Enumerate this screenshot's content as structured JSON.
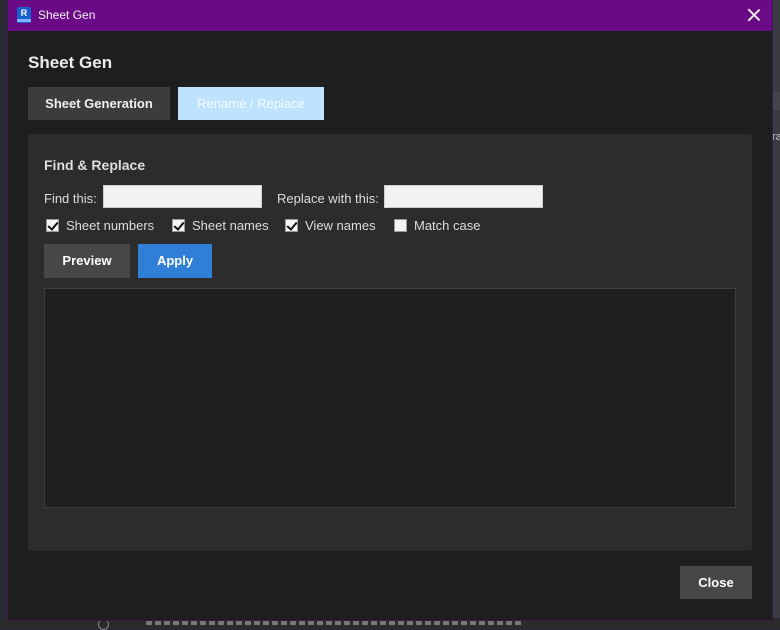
{
  "window": {
    "title": "Sheet Gen",
    "app_icon_letter": "R"
  },
  "dialog": {
    "heading": "Sheet Gen"
  },
  "tabs": [
    {
      "label": "Sheet Generation",
      "active": false
    },
    {
      "label": "Rename / Replace",
      "active": true
    }
  ],
  "find_replace": {
    "section_title": "Find & Replace",
    "find_label": "Find this:",
    "find_value": "",
    "replace_label": "Replace with this:",
    "replace_value": "",
    "options": [
      {
        "label": "Sheet numbers",
        "checked": true
      },
      {
        "label": "Sheet names",
        "checked": true
      },
      {
        "label": "View names",
        "checked": true
      },
      {
        "label": "Match case",
        "checked": false
      }
    ],
    "preview_label": "Preview",
    "apply_label": "Apply",
    "output_text": ""
  },
  "footer": {
    "close_label": "Close"
  },
  "background": {
    "edge_text": "ra"
  },
  "colors": {
    "titlebar": "#6a0a86",
    "apply_button": "#2f7fd6",
    "active_tab": "#bfe3ff"
  }
}
